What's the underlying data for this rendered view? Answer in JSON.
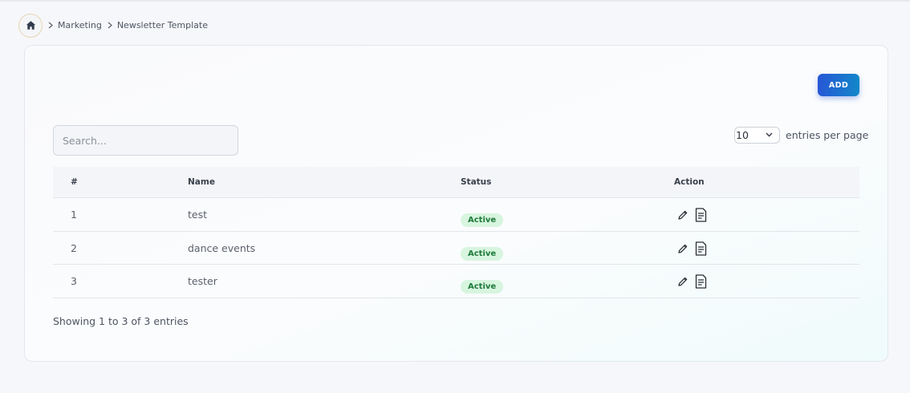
{
  "breadcrumb": {
    "home_icon": "home-icon",
    "items": [
      "Marketing",
      "Newsletter Template"
    ]
  },
  "toolbar": {
    "add_label": "ADD"
  },
  "search": {
    "placeholder": "Search..."
  },
  "pagination": {
    "per_page_value": "10",
    "per_page_label": "entries per page",
    "showing_text": "Showing 1 to 3 of 3 entries"
  },
  "table": {
    "headers": [
      "#",
      "Name",
      "Status",
      "Action"
    ],
    "rows": [
      {
        "num": "1",
        "name": "test",
        "status": "Active"
      },
      {
        "num": "2",
        "name": "dance events",
        "status": "Active"
      },
      {
        "num": "3",
        "name": "tester",
        "status": "Active"
      }
    ],
    "action_icons": [
      "pencil-icon",
      "document-icon"
    ]
  },
  "colors": {
    "accent_start": "#2757d6",
    "accent_end": "#1287c9",
    "status_active_bg": "#d7f5df",
    "status_active_text": "#1f7a3a"
  }
}
